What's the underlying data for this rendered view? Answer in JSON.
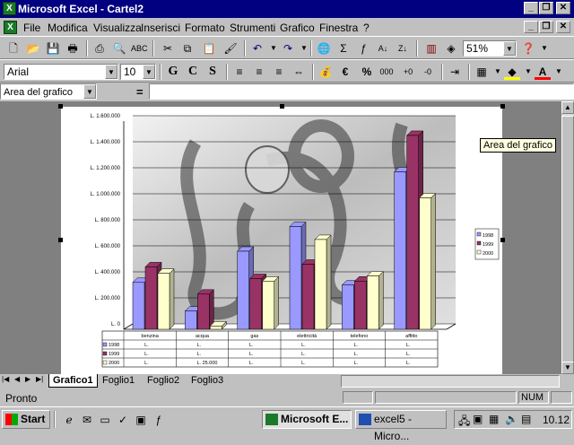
{
  "window": {
    "title": "Microsoft Excel - Cartel2",
    "app_icon": "excel-icon"
  },
  "menu": [
    "File",
    "Modifica",
    "Visualizza",
    "Inserisci",
    "Formato",
    "Strumenti",
    "Grafico",
    "Finestra",
    "?"
  ],
  "toolbar": {
    "zoom": "51%"
  },
  "format": {
    "font": "Arial",
    "size": "10",
    "bold": "G",
    "italic": "C",
    "underline": "S",
    "currency": "€",
    "percent": "%"
  },
  "formula_bar": {
    "name_box": "Area del grafico",
    "equals": "="
  },
  "tooltip": "Area del grafico",
  "chart_data": {
    "type": "bar",
    "categories": [
      "benzina",
      "acqua",
      "gas",
      "elettricità",
      "telefono",
      "affitto"
    ],
    "series": [
      {
        "name": "1998",
        "values": [
          360000,
          140000,
          600000,
          790000,
          340000,
          1210000
        ],
        "color": "#9999ff"
      },
      {
        "name": "1999",
        "values": [
          480000,
          270000,
          390000,
          500000,
          370000,
          1490000
        ],
        "color": "#993366"
      },
      {
        "name": "2000",
        "values": [
          430000,
          25000,
          370000,
          690000,
          410000,
          1010000
        ],
        "color": "#ffffcc"
      }
    ],
    "ylim": [
      0,
      1600000
    ],
    "yticks": [
      "L. 0",
      "L. 200.000",
      "L. 400.000",
      "L. 600.000",
      "L. 800.000",
      "L. 1.000.000",
      "L. 1.200.000",
      "L. 1.400.000",
      "L. 1.600.000"
    ],
    "table_rows": [
      {
        "label": "1998",
        "cells": [
          "L.",
          "L.",
          "L.",
          "L.",
          "L.",
          "L."
        ]
      },
      {
        "label": "1999",
        "cells": [
          "L.",
          "L.",
          "L.",
          "L.",
          "L.",
          "L."
        ]
      },
      {
        "label": "2000",
        "cells": [
          "L.",
          "L. 25.000",
          "L.",
          "L.",
          "L.",
          "L."
        ]
      }
    ],
    "legend": [
      "1998",
      "1999",
      "2000"
    ],
    "legend_placement": "right",
    "grid": true
  },
  "sheet_tabs": [
    "Grafico1",
    "Foglio1",
    "Foglio2",
    "Foglio3"
  ],
  "status": {
    "text": "Pronto",
    "num": "NUM"
  },
  "taskbar": {
    "start": "Start",
    "tasks": [
      "Microsoft E...",
      "excel5 - Micro..."
    ],
    "clock": "10.12"
  }
}
